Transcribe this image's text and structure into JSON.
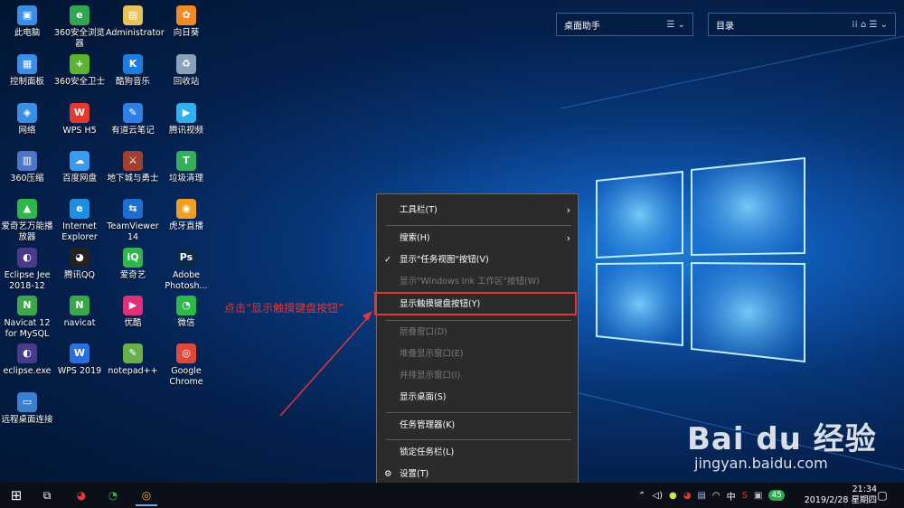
{
  "desktop_icons": [
    {
      "label": "此电脑",
      "color": "#3a8ee6",
      "glyph": "▣"
    },
    {
      "label": "360安全浏览器",
      "color": "#2fa84f",
      "glyph": "e"
    },
    {
      "label": "Administrator",
      "color": "#e8c15a",
      "glyph": "▤"
    },
    {
      "label": "向日葵",
      "color": "#f08a24",
      "glyph": "✿"
    },
    {
      "label": "控制面板",
      "color": "#3a8ee6",
      "glyph": "▦"
    },
    {
      "label": "360安全卫士",
      "color": "#5cb531",
      "glyph": "+"
    },
    {
      "label": "酷狗音乐",
      "color": "#1a7fe0",
      "glyph": "K"
    },
    {
      "label": "回收站",
      "color": "#8aa2b8",
      "glyph": "♻"
    },
    {
      "label": "网络",
      "color": "#3a8ee6",
      "glyph": "◈"
    },
    {
      "label": "WPS H5",
      "color": "#e23a32",
      "glyph": "W"
    },
    {
      "label": "有道云笔记",
      "color": "#2f7fe8",
      "glyph": "✎"
    },
    {
      "label": "腾讯视频",
      "color": "#2fb0f0",
      "glyph": "▶"
    },
    {
      "label": "360压缩",
      "color": "#4a76c8",
      "glyph": "▥"
    },
    {
      "label": "百度网盘",
      "color": "#3a9af0",
      "glyph": "☁"
    },
    {
      "label": "地下城与勇士",
      "color": "#a04030",
      "glyph": "⚔"
    },
    {
      "label": "垃圾清理",
      "color": "#35b05a",
      "glyph": "T"
    },
    {
      "label": "爱奇艺万能播放器",
      "color": "#2fb84a",
      "glyph": "▲"
    },
    {
      "label": "Internet Explorer",
      "color": "#1d8ee0",
      "glyph": "e"
    },
    {
      "label": "TeamViewer 14",
      "color": "#1a6fd0",
      "glyph": "⇆"
    },
    {
      "label": "虎牙直播",
      "color": "#f0a020",
      "glyph": "◉"
    },
    {
      "label": "Eclipse Jee 2018-12",
      "color": "#4a3b8a",
      "glyph": "◐"
    },
    {
      "label": "腾讯QQ",
      "color": "#222",
      "glyph": "◕"
    },
    {
      "label": "爱奇艺",
      "color": "#2fb84a",
      "glyph": "iQ"
    },
    {
      "label": "Adobe Photosh...",
      "color": "#0b2a4a",
      "glyph": "Ps"
    },
    {
      "label": "Navicat 12 for MySQL",
      "color": "#3aa84a",
      "glyph": "N"
    },
    {
      "label": "navicat",
      "color": "#3aa84a",
      "glyph": "N"
    },
    {
      "label": "优酷",
      "color": "#e0307a",
      "glyph": "▶"
    },
    {
      "label": "微信",
      "color": "#2fb84a",
      "glyph": "◔"
    },
    {
      "label": "eclipse.exe",
      "color": "#4a3b8a",
      "glyph": "◐"
    },
    {
      "label": "WPS 2019",
      "color": "#2a6fe0",
      "glyph": "W"
    },
    {
      "label": "notepad++",
      "color": "#6ab04a",
      "glyph": "✎"
    },
    {
      "label": "Google Chrome",
      "color": "#dd4a38",
      "glyph": "◎"
    },
    {
      "label": "远程桌面连接",
      "color": "#3a7fd0",
      "glyph": "▭"
    }
  ],
  "widgets": {
    "assistant": {
      "title": "桌面助手",
      "icons": "☰ ⌄"
    },
    "catalog": {
      "title": "目录",
      "icons": "⁞⁞ ⌂ ☰ ⌄"
    }
  },
  "context_menu": {
    "items": [
      {
        "label": "工具栏(T)",
        "state": "submenu"
      },
      {
        "label": "搜索(H)",
        "state": "submenu"
      },
      {
        "label": "显示\"任务视图\"按钮(V)",
        "state": "checked"
      },
      {
        "label": "显示\"Windows Ink 工作区\"按钮(W)",
        "state": "disabled"
      },
      {
        "label": "显示触摸键盘按钮(Y)",
        "state": "normal"
      },
      {
        "label": "层叠窗口(D)",
        "state": "disabled"
      },
      {
        "label": "堆叠显示窗口(E)",
        "state": "disabled"
      },
      {
        "label": "并排显示窗口(I)",
        "state": "disabled"
      },
      {
        "label": "显示桌面(S)",
        "state": "normal"
      },
      {
        "label": "任务管理器(K)",
        "state": "normal"
      },
      {
        "label": "锁定任务栏(L)",
        "state": "normal"
      },
      {
        "label": "设置(T)",
        "state": "gear"
      }
    ]
  },
  "annotation": "点击“显示触摸键盘按钮”",
  "taskbar": {
    "start": "⊞",
    "task_view": "⧉",
    "qq": "◕",
    "wechat": "◔",
    "chrome": "◎",
    "tray": {
      "chevron": "⌃",
      "ime": "中",
      "badge": "45"
    },
    "time": "21:34",
    "date": "2019/2/28 星期四",
    "notifications": "▢"
  },
  "watermark": {
    "brand": "Bai du 经验",
    "url": "jingyan.baidu.com"
  },
  "colors": {
    "highlight": "#e0353b",
    "menu_bg": "#2b2b2b",
    "taskbar": "#0b0f18"
  }
}
